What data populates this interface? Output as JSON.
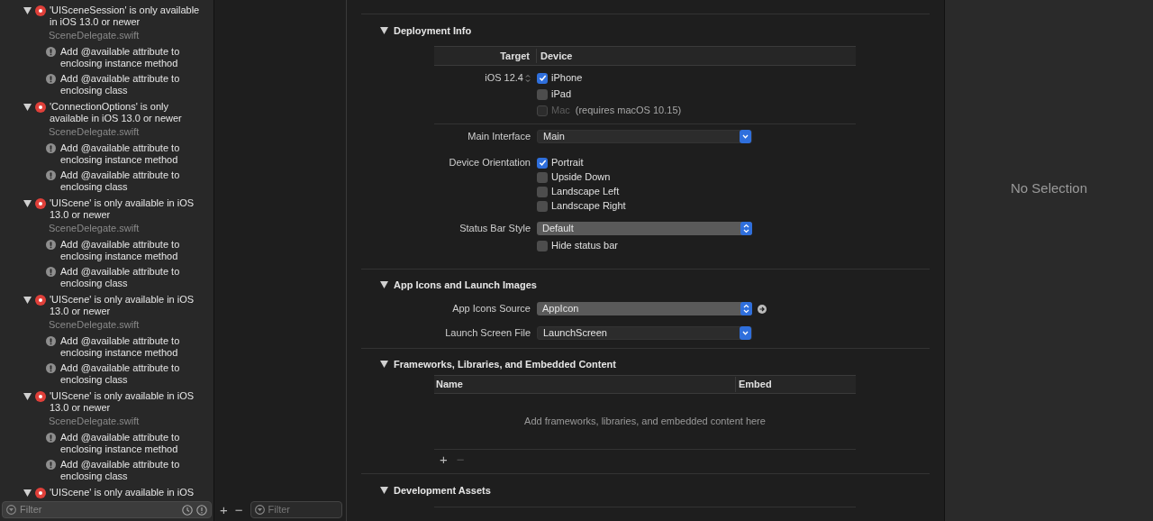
{
  "issues": [
    {
      "kind": "error",
      "title": "'UISceneSession' is only available in iOS 13.0 or newer",
      "file": "SceneDelegate.swift",
      "expanded": true,
      "children": [
        {
          "kind": "fixit",
          "title": "Add @available attribute to enclosing instance method"
        },
        {
          "kind": "fixit",
          "title": "Add @available attribute to enclosing class"
        }
      ]
    },
    {
      "kind": "error",
      "title": "'ConnectionOptions' is only available in iOS 13.0 or newer",
      "file": "SceneDelegate.swift",
      "expanded": true,
      "children": [
        {
          "kind": "fixit",
          "title": "Add @available attribute to enclosing instance method"
        },
        {
          "kind": "fixit",
          "title": "Add @available attribute to enclosing class"
        }
      ]
    },
    {
      "kind": "error",
      "title": "'UIScene' is only available in iOS 13.0 or newer",
      "file": "SceneDelegate.swift",
      "expanded": true,
      "children": [
        {
          "kind": "fixit",
          "title": "Add @available attribute to enclosing instance method"
        },
        {
          "kind": "fixit",
          "title": "Add @available attribute to enclosing class"
        }
      ]
    },
    {
      "kind": "error",
      "title": "'UIScene' is only available in iOS 13.0 or newer",
      "file": "SceneDelegate.swift",
      "expanded": true,
      "children": [
        {
          "kind": "fixit",
          "title": "Add @available attribute to enclosing instance method"
        },
        {
          "kind": "fixit",
          "title": "Add @available attribute to enclosing class"
        }
      ]
    },
    {
      "kind": "error",
      "title": "'UIScene' is only available in iOS 13.0 or newer",
      "file": "SceneDelegate.swift",
      "expanded": true,
      "children": [
        {
          "kind": "fixit",
          "title": "Add @available attribute to enclosing instance method"
        },
        {
          "kind": "fixit",
          "title": "Add @available attribute to enclosing class"
        }
      ]
    },
    {
      "kind": "error",
      "title": "'UIScene' is only available in iOS",
      "expanded": true
    }
  ],
  "issue_filter": {
    "placeholder": "Filter"
  },
  "targets_bar": {
    "add": "+",
    "remove": "−",
    "filter_placeholder": "Filter"
  },
  "deployment": {
    "title": "Deployment Info",
    "expanded": true,
    "columns": [
      "Target",
      "Device"
    ],
    "target": "iOS 12.4",
    "devices": [
      {
        "label": "iPhone",
        "checked": true,
        "disabled": false
      },
      {
        "label": "iPad",
        "checked": false,
        "disabled": false
      },
      {
        "label": "Mac",
        "checked": false,
        "disabled": true,
        "note": "(requires macOS 10.15)"
      }
    ],
    "main_interface": {
      "label": "Main Interface",
      "value": "Main",
      "kind": "combo"
    },
    "orientation": {
      "label": "Device Orientation",
      "options": [
        {
          "label": "Portrait",
          "checked": true
        },
        {
          "label": "Upside Down",
          "checked": false
        },
        {
          "label": "Landscape Left",
          "checked": false
        },
        {
          "label": "Landscape Right",
          "checked": false
        }
      ]
    },
    "status_bar_style": {
      "label": "Status Bar Style",
      "value": "Default",
      "kind": "popup"
    },
    "hide_status_bar": {
      "label": "Hide status bar",
      "checked": false
    }
  },
  "app_icons": {
    "title": "App Icons and Launch Images",
    "expanded": true,
    "fields": [
      {
        "label": "App Icons Source",
        "value": "AppIcon",
        "kind": "popup",
        "link": true
      },
      {
        "label": "Launch Screen File",
        "value": "LaunchScreen",
        "kind": "combo",
        "link": false
      }
    ]
  },
  "frameworks": {
    "title": "Frameworks, Libraries, and Embedded Content",
    "expanded": true,
    "columns": [
      "Name",
      "Embed"
    ],
    "empty_text": "Add frameworks, libraries, and embedded content here",
    "add": "+",
    "remove": "−"
  },
  "development_assets": {
    "title": "Development Assets",
    "expanded": true
  },
  "inspector": {
    "empty_text": "No Selection"
  }
}
